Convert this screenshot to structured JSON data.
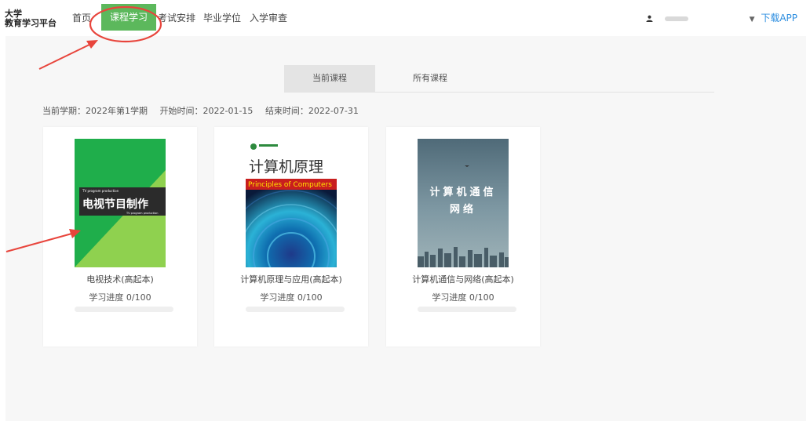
{
  "header": {
    "brand_line1": "大学",
    "brand_line2": "教育学习平台",
    "nav": [
      {
        "label": "首页"
      },
      {
        "label": "课程学习"
      },
      {
        "label": "考试安排"
      },
      {
        "label": "毕业学位"
      },
      {
        "label": "入学审查"
      }
    ],
    "download": "下载APP"
  },
  "tabs": [
    "当前课程",
    "所有课程"
  ],
  "term": {
    "semester": "当前学期：2022年第1学期",
    "start": "开始时间：2022-01-15",
    "end": "结束时间：2022-07-31"
  },
  "courses": [
    {
      "title": "电视技术(高起本)",
      "progress_text": "学习进度 0/100",
      "progress": 0,
      "cover": {
        "tag_top": "TV program production",
        "main": "电视节目制作",
        "tag_bottom": "TV program production"
      }
    },
    {
      "title": "计算机原理与应用(高起本)",
      "progress_text": "学习进度 0/100",
      "progress": 0,
      "cover": {
        "main": "计算机原理",
        "sub": "Principles of Computers"
      }
    },
    {
      "title": "计算机通信与网络(高起本)",
      "progress_text": "学习进度 0/100",
      "progress": 0,
      "cover": {
        "line1": "计算机通信",
        "line2": "网络"
      }
    }
  ],
  "colors": {
    "accent": "#5cb85c",
    "link": "#2f8fe0",
    "annotation": "#e8453c"
  }
}
